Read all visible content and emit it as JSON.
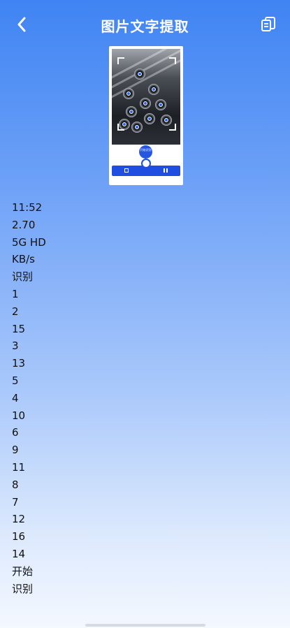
{
  "header": {
    "title": "图片文字提取",
    "back_icon": "chevron-left-icon",
    "copy_icon": "copy-document-icon"
  },
  "thumbnail": {
    "start_label": "开始识别"
  },
  "extracted_lines": [
    "11:52",
    "2.70",
    "5G HD",
    "KB/s",
    "识别",
    "1",
    "2",
    "15",
    "3",
    "13",
    "5",
    "4",
    "10",
    "6",
    "9",
    "11",
    "8",
    "7",
    "12",
    "16",
    "14",
    "开始",
    "识别"
  ],
  "colors": {
    "accent": "#2456e0",
    "background_top": "#3f84f3",
    "background_bottom": "#f4f8ff"
  }
}
